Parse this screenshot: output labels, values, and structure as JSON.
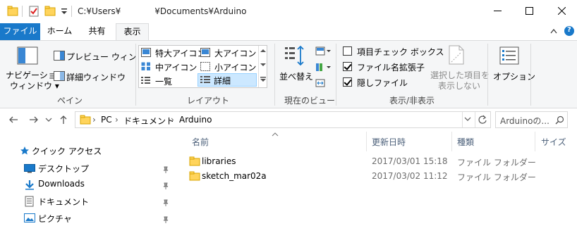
{
  "title_bar": {
    "path": "C:¥Users¥　　　　¥Documents¥Arduino",
    "minimize_icon": "minimize-icon",
    "maximize_icon": "maximize-icon",
    "close_icon": "close-icon"
  },
  "tabs": {
    "file": "ファイル",
    "home": "ホーム",
    "share": "共有",
    "view": "表示"
  },
  "ribbon": {
    "pane": {
      "nav_pane_line1": "ナビゲーション",
      "nav_pane_line2": "ウィンドウ ▾",
      "preview_pane": "プレビュー ウィンドウ",
      "details_pane": "詳細ウィンドウ",
      "group_label": "ペイン"
    },
    "layout": {
      "extra_large": "特大アイコン",
      "large": "大アイコン",
      "medium": "中アイコン",
      "small": "小アイコン",
      "list": "一覧",
      "details": "詳細",
      "group_label": "レイアウト"
    },
    "current_view": {
      "sort_by": "並べ替え",
      "group_label": "現在のビュー"
    },
    "show_hide": {
      "item_checkboxes": "項目チェック ボックス",
      "item_checkboxes_checked": false,
      "file_extensions": "ファイル名拡張子",
      "file_extensions_checked": true,
      "hidden_items": "隠しファイル",
      "hidden_items_checked": true,
      "hide_selected_line1": "選択した項目を",
      "hide_selected_line2": "表示しない",
      "group_label": "表示/非表示"
    },
    "options": "オプション"
  },
  "address": {
    "crumbs": [
      "PC",
      "ドキュメント",
      "Arduino"
    ],
    "search_placeholder": "Arduinoの..."
  },
  "nav_pane": {
    "items": [
      {
        "label": "クイック アクセス",
        "icon": "star-icon"
      },
      {
        "label": "デスクトップ",
        "icon": "desktop-icon",
        "pinned": true
      },
      {
        "label": "Downloads",
        "icon": "download-icon",
        "pinned": true
      },
      {
        "label": "ドキュメント",
        "icon": "documents-icon",
        "pinned": true
      },
      {
        "label": "ピクチャ",
        "icon": "pictures-icon",
        "pinned": true
      }
    ]
  },
  "file_list": {
    "columns": [
      "名前",
      "更新日時",
      "種類",
      "サイズ"
    ],
    "rows": [
      {
        "name": "libraries",
        "modified": "2017/03/01 15:18",
        "type": "ファイル フォルダー"
      },
      {
        "name": "sketch_mar02a",
        "modified": "2017/03/02 11:12",
        "type": "ファイル フォルダー"
      }
    ]
  },
  "colors": {
    "file_tab": "#1979ca",
    "ribbon_bg": "#f5f6f7",
    "folder": "#ffd45c",
    "selection": "#cce8ff"
  }
}
